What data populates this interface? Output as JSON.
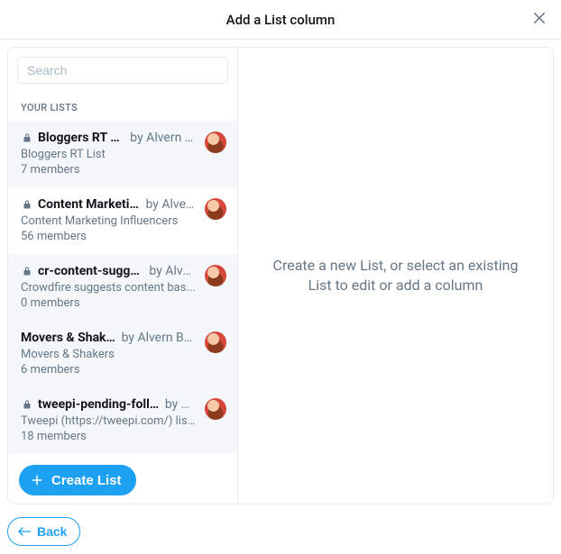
{
  "header": {
    "title": "Add a List column"
  },
  "search": {
    "placeholder": "Search",
    "value": ""
  },
  "section_label": "YOUR LISTS",
  "by_prefix": "by",
  "lists": [
    {
      "name": "Bloggers RT List",
      "author": "Alvern B...",
      "desc": "Bloggers RT List",
      "members": "7 members",
      "private": true,
      "selected": false
    },
    {
      "name": "Content Marketing",
      "author": "Alver...",
      "desc": "Content Marketing Influencers",
      "members": "56 members",
      "private": true,
      "selected": true
    },
    {
      "name": "cr-content-suggest",
      "author": "Alve...",
      "desc": "Crowdfire suggests content bas...",
      "members": "0 members",
      "private": true,
      "selected": false
    },
    {
      "name": "Movers & Shakers",
      "author": "Alvern Bul...",
      "desc": "Movers & Shakers",
      "members": "6 members",
      "private": false,
      "selected": false
    },
    {
      "name": "tweepi-pending-follow",
      "author": "A...",
      "desc": "Tweepi (https://tweepi.com/) list ...",
      "members": "18 members",
      "private": true,
      "selected": false
    }
  ],
  "create_label": "Create List",
  "empty_message": "Create a new List, or select an existing List to edit or add a column",
  "back_label": "Back"
}
